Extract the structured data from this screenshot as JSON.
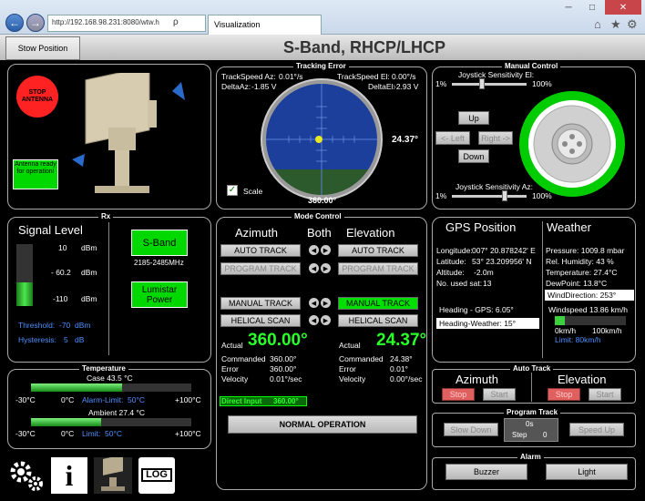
{
  "browser": {
    "address": "http://192.168.98.231:8080/wtw.h",
    "search_sym": "ρ",
    "tab_title": "Visualization",
    "win_min": "─",
    "win_max": "□",
    "win_close": "✕",
    "home_sym": "⌂",
    "star_sym": "★",
    "gear_sym": "⚙",
    "back_sym": "←",
    "fwd_sym": "→"
  },
  "header": {
    "stow_label": "Stow Position",
    "title": "S-Band, RHCP/LHCP"
  },
  "antenna": {
    "stop_label": "STOP ANTENNA",
    "status": "Antenna ready for operation!"
  },
  "tracking": {
    "label": "Tracking Error",
    "speed_az_label": "TrackSpeed Az:",
    "speed_az": "0.01°/s",
    "delta_az_label": "DeltaAz:",
    "delta_az": "-1.85 V",
    "speed_el_label": "TrackSpeed El:",
    "speed_el": "0.00°/s",
    "delta_el_label": "DeltaEl:",
    "delta_el": "-2.93 V",
    "el_reading": "24.37°",
    "az_reading": "360.00°",
    "scale_label": "Scale",
    "scale_checked": true
  },
  "manual": {
    "label": "Manual Control",
    "sens_el_label": "Joystick Sensitivity El:",
    "sens_el_min": "1%",
    "sens_el_max": "100%",
    "sens_el_value": 0.4,
    "up": "Up",
    "left": "<- Left",
    "right": "Right ->",
    "down": "Down",
    "sens_az_label": "Joystick Sensitivity Az:",
    "sens_az_min": "1%",
    "sens_az_max": "100%",
    "sens_az_value": 0.72
  },
  "rx": {
    "label": "Rx",
    "signal_title": "Signal Level",
    "scale_top": "10",
    "scale_mid": "- 60.2",
    "scale_bot": "-110",
    "unit": "dBm",
    "signal_level": 0.38,
    "threshold_label": "Threshold:",
    "threshold": "-70",
    "threshold_unit": "dBm",
    "hyst_label": "Hysteresis:",
    "hyst": "5",
    "hyst_unit": "dB",
    "band_label": "S-Band",
    "band_range": "2185-2485MHz",
    "power_label": "Lumistar Power"
  },
  "mode": {
    "label": "Mode Control",
    "az_title": "Azimuth",
    "both_title": "Both",
    "el_title": "Elevation",
    "auto_track": "AUTO TRACK",
    "program_track": "PROGRAM TRACK",
    "manual_track": "MANUAL TRACK",
    "helical_scan": "HELICAL SCAN",
    "actual_label": "Actual",
    "az_actual": "360.00°",
    "el_actual": "24.37°",
    "commanded_label": "Commanded",
    "az_commanded": "360.00°",
    "el_commanded": "24.38°",
    "error_label": "Error",
    "az_error": "360.00°",
    "el_error": "0.01°",
    "velocity_label": "Velocity",
    "az_velocity": "0.01°/sec",
    "el_velocity": "0.00°/sec",
    "direct_label": "Direct Input",
    "direct_value": "360.00°",
    "normal_op": "NORMAL OPERATION"
  },
  "gps": {
    "title": "GPS Position",
    "lon_label": "Longitude:",
    "lon": "007° 20.878242' E",
    "lat_label": "Latitude:",
    "lat": "53° 23.209956' N",
    "alt_label": "Altitude:",
    "alt": "-2.0m",
    "sats_label": "No. used sat:",
    "sats": "13",
    "heading_gps": "Heading - GPS: 6.05°",
    "heading_weather": "Heading-Weather:  15°"
  },
  "weather": {
    "title": "Weather",
    "pressure": "Pressure: 1009.8 mbar",
    "humidity": "Rel. Humidity:  43 %",
    "temperature": "Temperature: 27.4°C",
    "dewpoint": "DewPoint: 13.8°C",
    "wind_dir": "WindDirection: 253°",
    "windspeed": "Windspeed 13.86 km/h",
    "wind_min": "0km/h",
    "wind_max": "100km/h",
    "wind_limit": "Limit:  80km/h",
    "wind_level": 0.14
  },
  "temp": {
    "label": "Temperature",
    "case_label": "Case 43.5 °C",
    "ambient_label": "Ambient 27.4 °C",
    "min": "-30°C",
    "zero": "0°C",
    "max": "+100°C",
    "alarm_label": "Alarm-Limit:",
    "alarm_value": "50°C",
    "limit_label": "Limit:",
    "limit_value": "50°C",
    "case_level": 0.57,
    "ambient_level": 0.44
  },
  "autotrack": {
    "label": "Auto Track",
    "az_title": "Azimuth",
    "el_title": "Elevation",
    "stop": "Stop",
    "start": "Start"
  },
  "program": {
    "label": "Program Track",
    "slow": "Slow Down",
    "speed": "Speed Up",
    "value": "0s",
    "step_label": "Step",
    "step_value": "0"
  },
  "alarm": {
    "label": "Alarm",
    "buzzer": "Buzzer",
    "light": "Light"
  },
  "bottom": {
    "log_label": "LOG",
    "info_sym": "i"
  }
}
